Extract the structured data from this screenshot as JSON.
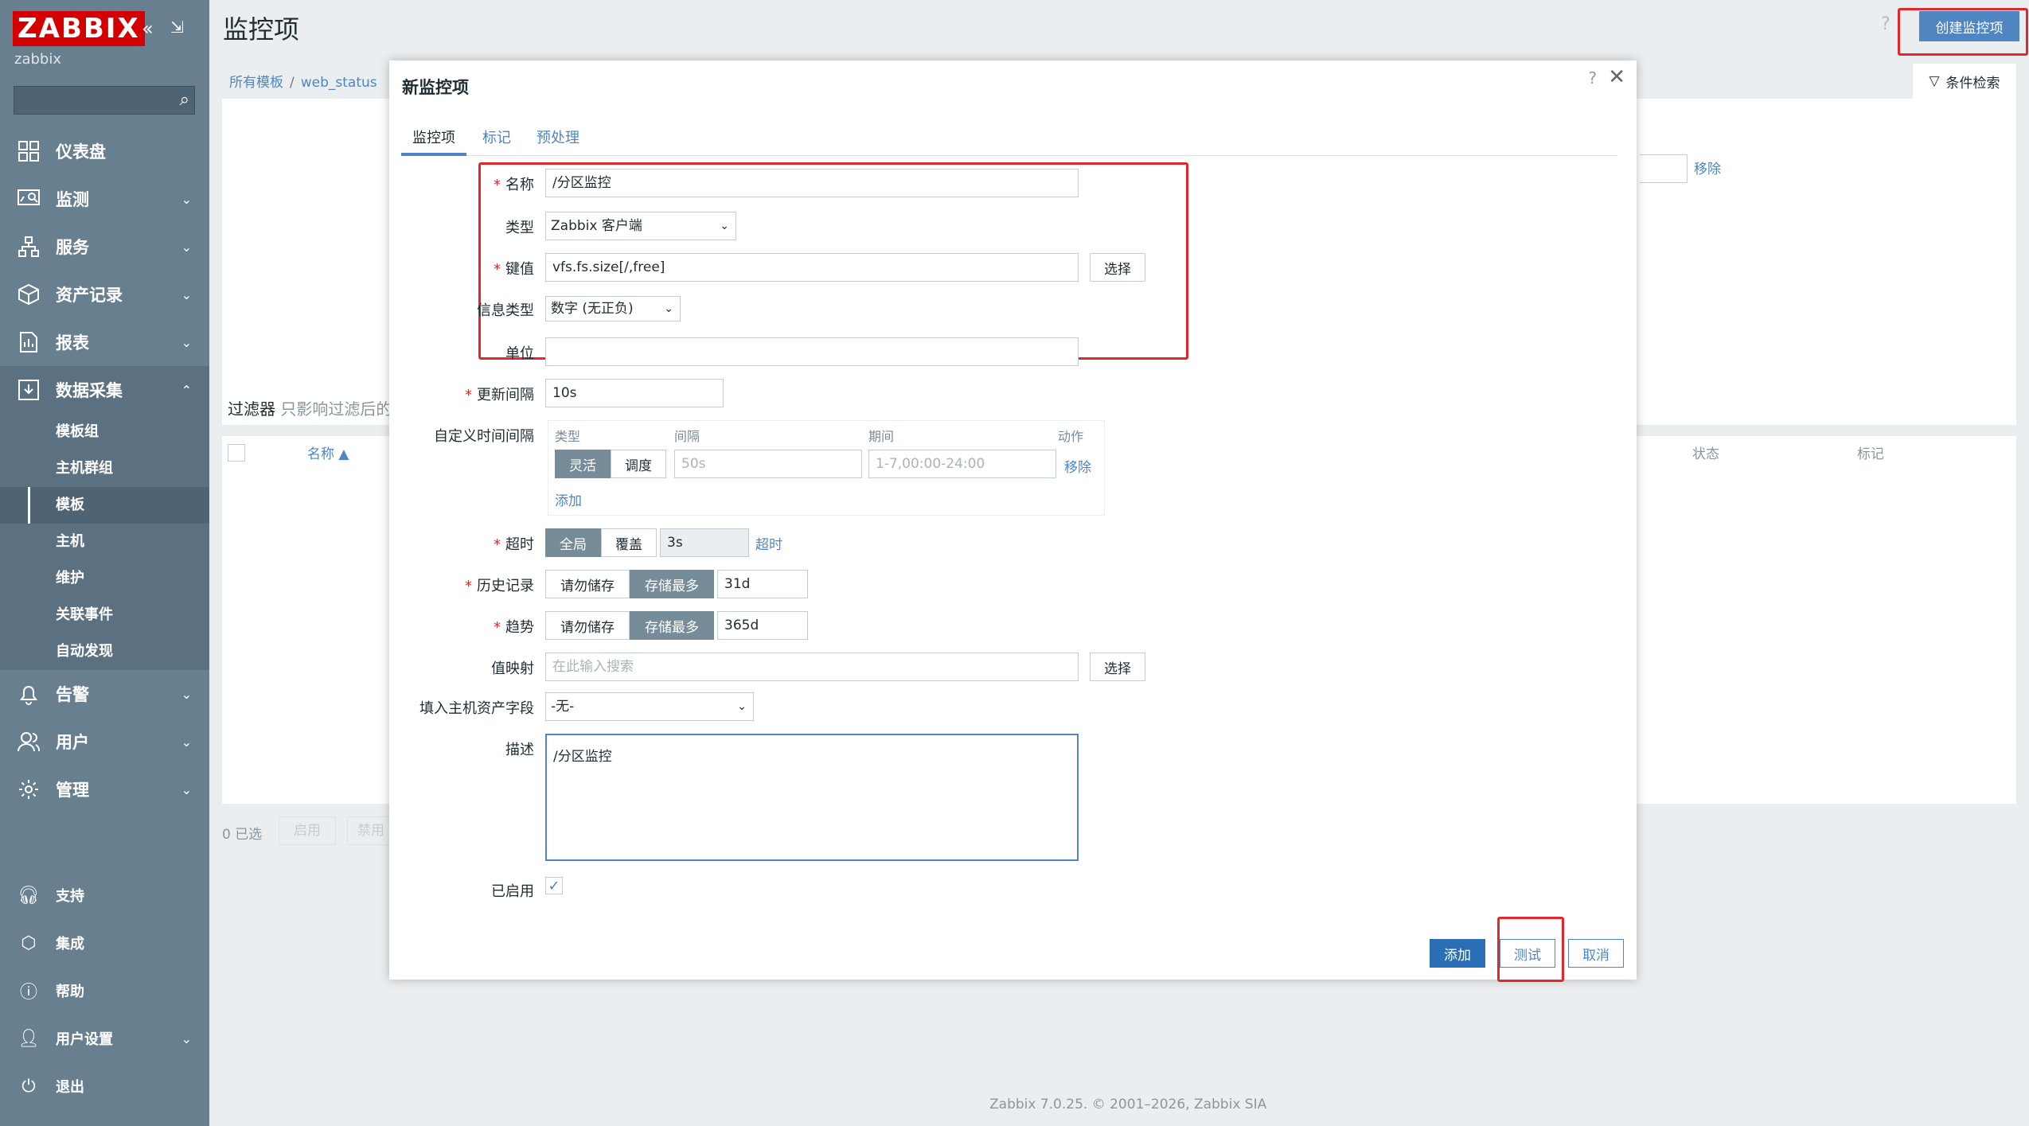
{
  "sidebar": {
    "logo": "ZABBIX",
    "user": "zabbix",
    "search_placeholder": "",
    "menu": [
      {
        "label": "仪表盘",
        "icon": "dashboard-icon"
      },
      {
        "label": "监测",
        "icon": "monitoring-icon"
      },
      {
        "label": "服务",
        "icon": "services-icon"
      },
      {
        "label": "资产记录",
        "icon": "inventory-icon"
      },
      {
        "label": "报表",
        "icon": "reports-icon"
      },
      {
        "label": "数据采集",
        "icon": "data-collection-icon"
      }
    ],
    "submenu": [
      "模板组",
      "主机群组",
      "模板",
      "主机",
      "维护",
      "关联事件",
      "自动发现"
    ],
    "menu2": [
      {
        "label": "告警",
        "icon": "bell-icon"
      },
      {
        "label": "用户",
        "icon": "users-icon"
      },
      {
        "label": "管理",
        "icon": "gear-icon"
      }
    ],
    "bottom": [
      {
        "label": "支持",
        "icon": "headset-icon"
      },
      {
        "label": "集成",
        "icon": "integrations-icon"
      },
      {
        "label": "帮助",
        "icon": "help-icon"
      },
      {
        "label": "用户设置",
        "icon": "user-settings-icon"
      },
      {
        "label": "退出",
        "icon": "power-icon"
      }
    ]
  },
  "header": {
    "title": "监控项",
    "help": "?",
    "create_button": "创建监控项"
  },
  "breadcrumb": {
    "all_templates": "所有模板",
    "sep": "/",
    "template": "web_status"
  },
  "filter": {
    "label": "条件检索",
    "remove": "移除",
    "filter_title": "过滤器",
    "filter_hint": "只影响过滤后的"
  },
  "list": {
    "col_name": "名称 ▲",
    "col_status": "状态",
    "col_tags": "标记",
    "selected": "0 已选",
    "enable": "启用",
    "disable": "禁用"
  },
  "modal": {
    "title": "新监控项",
    "help": "?",
    "close": "✕",
    "tabs": [
      "监控项",
      "标记",
      "预处理"
    ],
    "fields": {
      "name_label": "名称",
      "name_value": "/分区监控",
      "type_label": "类型",
      "type_value": "Zabbix 客户端",
      "key_label": "键值",
      "key_value": "vfs.fs.size[/,free]",
      "select": "选择",
      "info_type_label": "信息类型",
      "info_type_value": "数字 (无正负)",
      "unit_label": "单位",
      "unit_value": "",
      "interval_label": "更新间隔",
      "interval_value": "10s",
      "custom_label": "自定义时间间隔",
      "custom_headers": [
        "类型",
        "间隔",
        "期间",
        "动作"
      ],
      "custom_seg": [
        "灵活",
        "调度"
      ],
      "custom_interval_ph": "50s",
      "custom_period_ph": "1-7,00:00-24:00",
      "custom_remove": "移除",
      "custom_add": "添加",
      "timeout_label": "超时",
      "timeout_seg": [
        "全局",
        "覆盖"
      ],
      "timeout_value": "3s",
      "timeout_link": "超时",
      "history_label": "历史记录",
      "history_seg": [
        "请勿储存",
        "存储最多"
      ],
      "history_value": "31d",
      "trends_label": "趋势",
      "trends_seg": [
        "请勿储存",
        "存储最多"
      ],
      "trends_value": "365d",
      "valuemap_label": "值映射",
      "valuemap_ph": "在此输入搜索",
      "inventory_label": "填入主机资产字段",
      "inventory_value": "-无-",
      "desc_label": "描述",
      "desc_value": "/分区监控",
      "enabled_label": "已启用"
    },
    "buttons": {
      "add": "添加",
      "test": "测试",
      "cancel": "取消"
    }
  },
  "footer": "Zabbix 7.0.25. © 2001–2026, Zabbix SIA"
}
